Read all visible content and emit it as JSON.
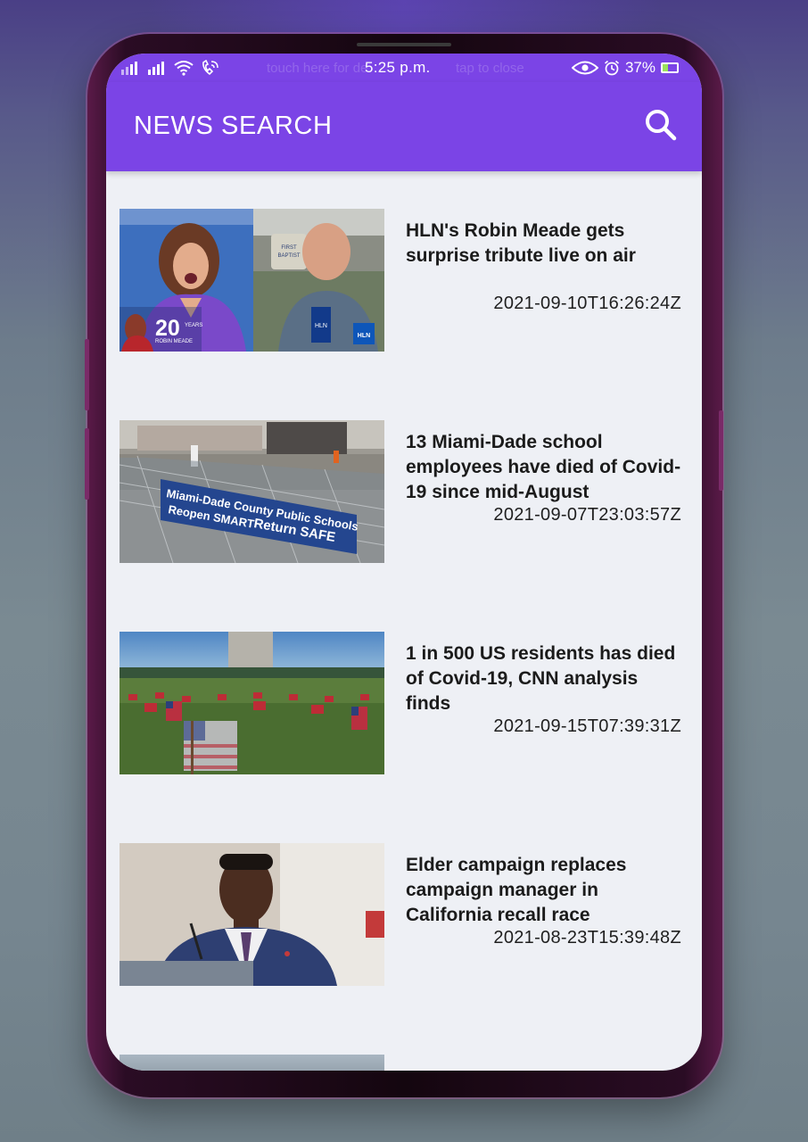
{
  "status_bar": {
    "time": "5:25 p.m.",
    "battery": "37%",
    "battery_level": 0.37,
    "ghost_left": "touch here for de",
    "ghost_right": "tap to close",
    "icons": [
      "signal-icon",
      "signal-icon",
      "wifi-icon",
      "wifi-calling-icon",
      "eye-icon",
      "alarm-icon",
      "battery-icon"
    ]
  },
  "app_bar": {
    "title": "NEWS SEARCH",
    "search_icon": "search-icon"
  },
  "colors": {
    "accent": "#7b44e6",
    "list_background": "#eef0f5",
    "text": "#1b1b1b"
  },
  "articles": [
    {
      "headline": "HLN's Robin Meade gets surprise tribute live on air",
      "published": "2021-09-10T16:26:24Z",
      "thumb_text": {
        "badge": "20",
        "badge_sub": "YEARS",
        "name": "ROBIN MEADE",
        "network": "HLN",
        "sign1": "FIRST",
        "sign2": "BAPTIST"
      }
    },
    {
      "headline": "13 Miami-Dade school employees have died of Covid-19 since mid-August",
      "published": "2021-09-07T23:03:57Z",
      "thumb_text": {
        "banner": "Miami-Dade County Public Schools",
        "slogan_a": "Reopen SMART",
        "slogan_b": "Return SAFE"
      }
    },
    {
      "headline": "1 in 500 US residents has died of Covid-19, CNN analysis finds",
      "published": "2021-09-15T07:39:31Z"
    },
    {
      "headline": "Elder campaign replaces campaign manager in California recall race",
      "published": "2021-08-23T15:39:48Z"
    }
  ]
}
